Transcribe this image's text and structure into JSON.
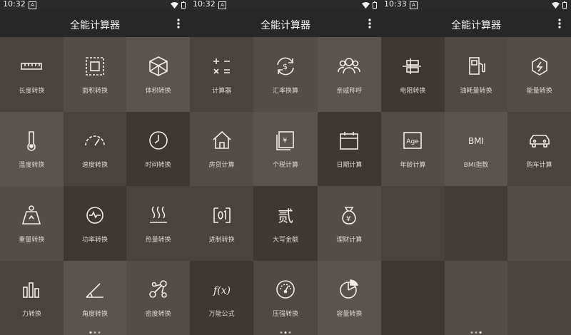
{
  "app": {
    "title": "全能计算器"
  },
  "panels": [
    {
      "time": "10:32",
      "tiles": [
        {
          "label": "长度转换",
          "icon": "ruler-icon"
        },
        {
          "label": "面积转换",
          "icon": "area-square-icon"
        },
        {
          "label": "体积转换",
          "icon": "cube-icon"
        },
        {
          "label": "温度转换",
          "icon": "thermometer-icon"
        },
        {
          "label": "速度转换",
          "icon": "speedometer-icon"
        },
        {
          "label": "时间转换",
          "icon": "clock-icon"
        },
        {
          "label": "重量转换",
          "icon": "weight-icon"
        },
        {
          "label": "功率转换",
          "icon": "power-gauge-icon"
        },
        {
          "label": "热量转换",
          "icon": "heat-waves-icon"
        },
        {
          "label": "力转换",
          "icon": "force-bars-icon"
        },
        {
          "label": "角度转换",
          "icon": "angle-icon"
        },
        {
          "label": "密度转换",
          "icon": "density-molecule-icon"
        }
      ]
    },
    {
      "time": "10:32",
      "tiles": [
        {
          "label": "计算器",
          "icon": "calculator-icon"
        },
        {
          "label": "汇率换算",
          "icon": "currency-exchange-icon"
        },
        {
          "label": "亲戚称呼",
          "icon": "family-icon"
        },
        {
          "label": "房贷计算",
          "icon": "house-icon"
        },
        {
          "label": "个税计算",
          "icon": "tax-document-icon"
        },
        {
          "label": "日期计算",
          "icon": "calendar-icon"
        },
        {
          "label": "进制转换",
          "icon": "binary-icon"
        },
        {
          "label": "大写金额",
          "icon": "chinese-numeral-icon",
          "glyph": "贰"
        },
        {
          "label": "理财计算",
          "icon": "money-bag-icon"
        },
        {
          "label": "万能公式",
          "icon": "function-icon",
          "glyph": "f(x)"
        },
        {
          "label": "压强转换",
          "icon": "pressure-gauge-icon"
        },
        {
          "label": "容量转换",
          "icon": "pie-chart-icon"
        }
      ]
    },
    {
      "time": "10:33",
      "tiles": [
        {
          "label": "电阻转换",
          "icon": "resistor-icon"
        },
        {
          "label": "油耗量转换",
          "icon": "fuel-pump-icon"
        },
        {
          "label": "能量转换",
          "icon": "energy-hexagon-icon"
        },
        {
          "label": "年龄计算",
          "icon": "age-icon",
          "glyph": "Age"
        },
        {
          "label": "BMI指数",
          "icon": "bmi-icon",
          "glyph": "BMI"
        },
        {
          "label": "购车计算",
          "icon": "car-icon"
        },
        {
          "label": "",
          "icon": ""
        },
        {
          "label": "",
          "icon": ""
        },
        {
          "label": "",
          "icon": ""
        },
        {
          "label": "",
          "icon": ""
        },
        {
          "label": "",
          "icon": ""
        },
        {
          "label": "",
          "icon": ""
        }
      ]
    }
  ],
  "colors": {
    "tile_dark": "#433b36",
    "tile_mid": "#504843",
    "tile_light": "#5c5550",
    "appbar": "#272727"
  }
}
